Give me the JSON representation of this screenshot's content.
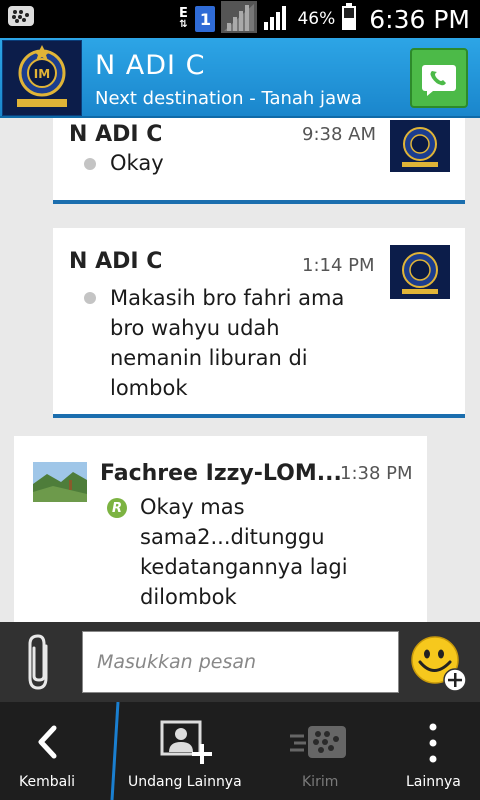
{
  "status_bar": {
    "network_type": "E",
    "sim_number": "1",
    "battery_percent": "46%",
    "time": "6:36 PM"
  },
  "header": {
    "contact_name": "N ADI C",
    "status_message": "Next destination - Tanah jawa",
    "avatar_icon": "inter-club-logo-icon",
    "call_icon": "phone-call-icon"
  },
  "messages": [
    {
      "sender": "N ADI C",
      "time": "9:38 AM",
      "text": [
        "Okay"
      ],
      "direction": "incoming"
    },
    {
      "sender": "N ADI C",
      "time": "1:14 PM",
      "text": [
        "Makasih bro fahri ama",
        "bro wahyu udah",
        "nemanin liburan di",
        "lombok"
      ],
      "direction": "incoming"
    },
    {
      "sender": "Fachree Izzy-LOM...",
      "time": "1:38 PM",
      "read_indicator": "R",
      "text": [
        "Okay mas",
        "sama2...ditunggu",
        "kedatangannya lagi",
        "dilombok"
      ],
      "direction": "outgoing"
    }
  ],
  "compose": {
    "placeholder": "Masukkan pesan",
    "value": ""
  },
  "action_bar": {
    "back_label": "Kembali",
    "invite_label": "Undang Lainnya",
    "send_label": "Kirim",
    "more_label": "Lainnya"
  },
  "colors": {
    "header_blue": "#1e94d8",
    "message_border": "#1b6eae",
    "call_green": "#4cba48",
    "read_green": "#7cb342"
  }
}
